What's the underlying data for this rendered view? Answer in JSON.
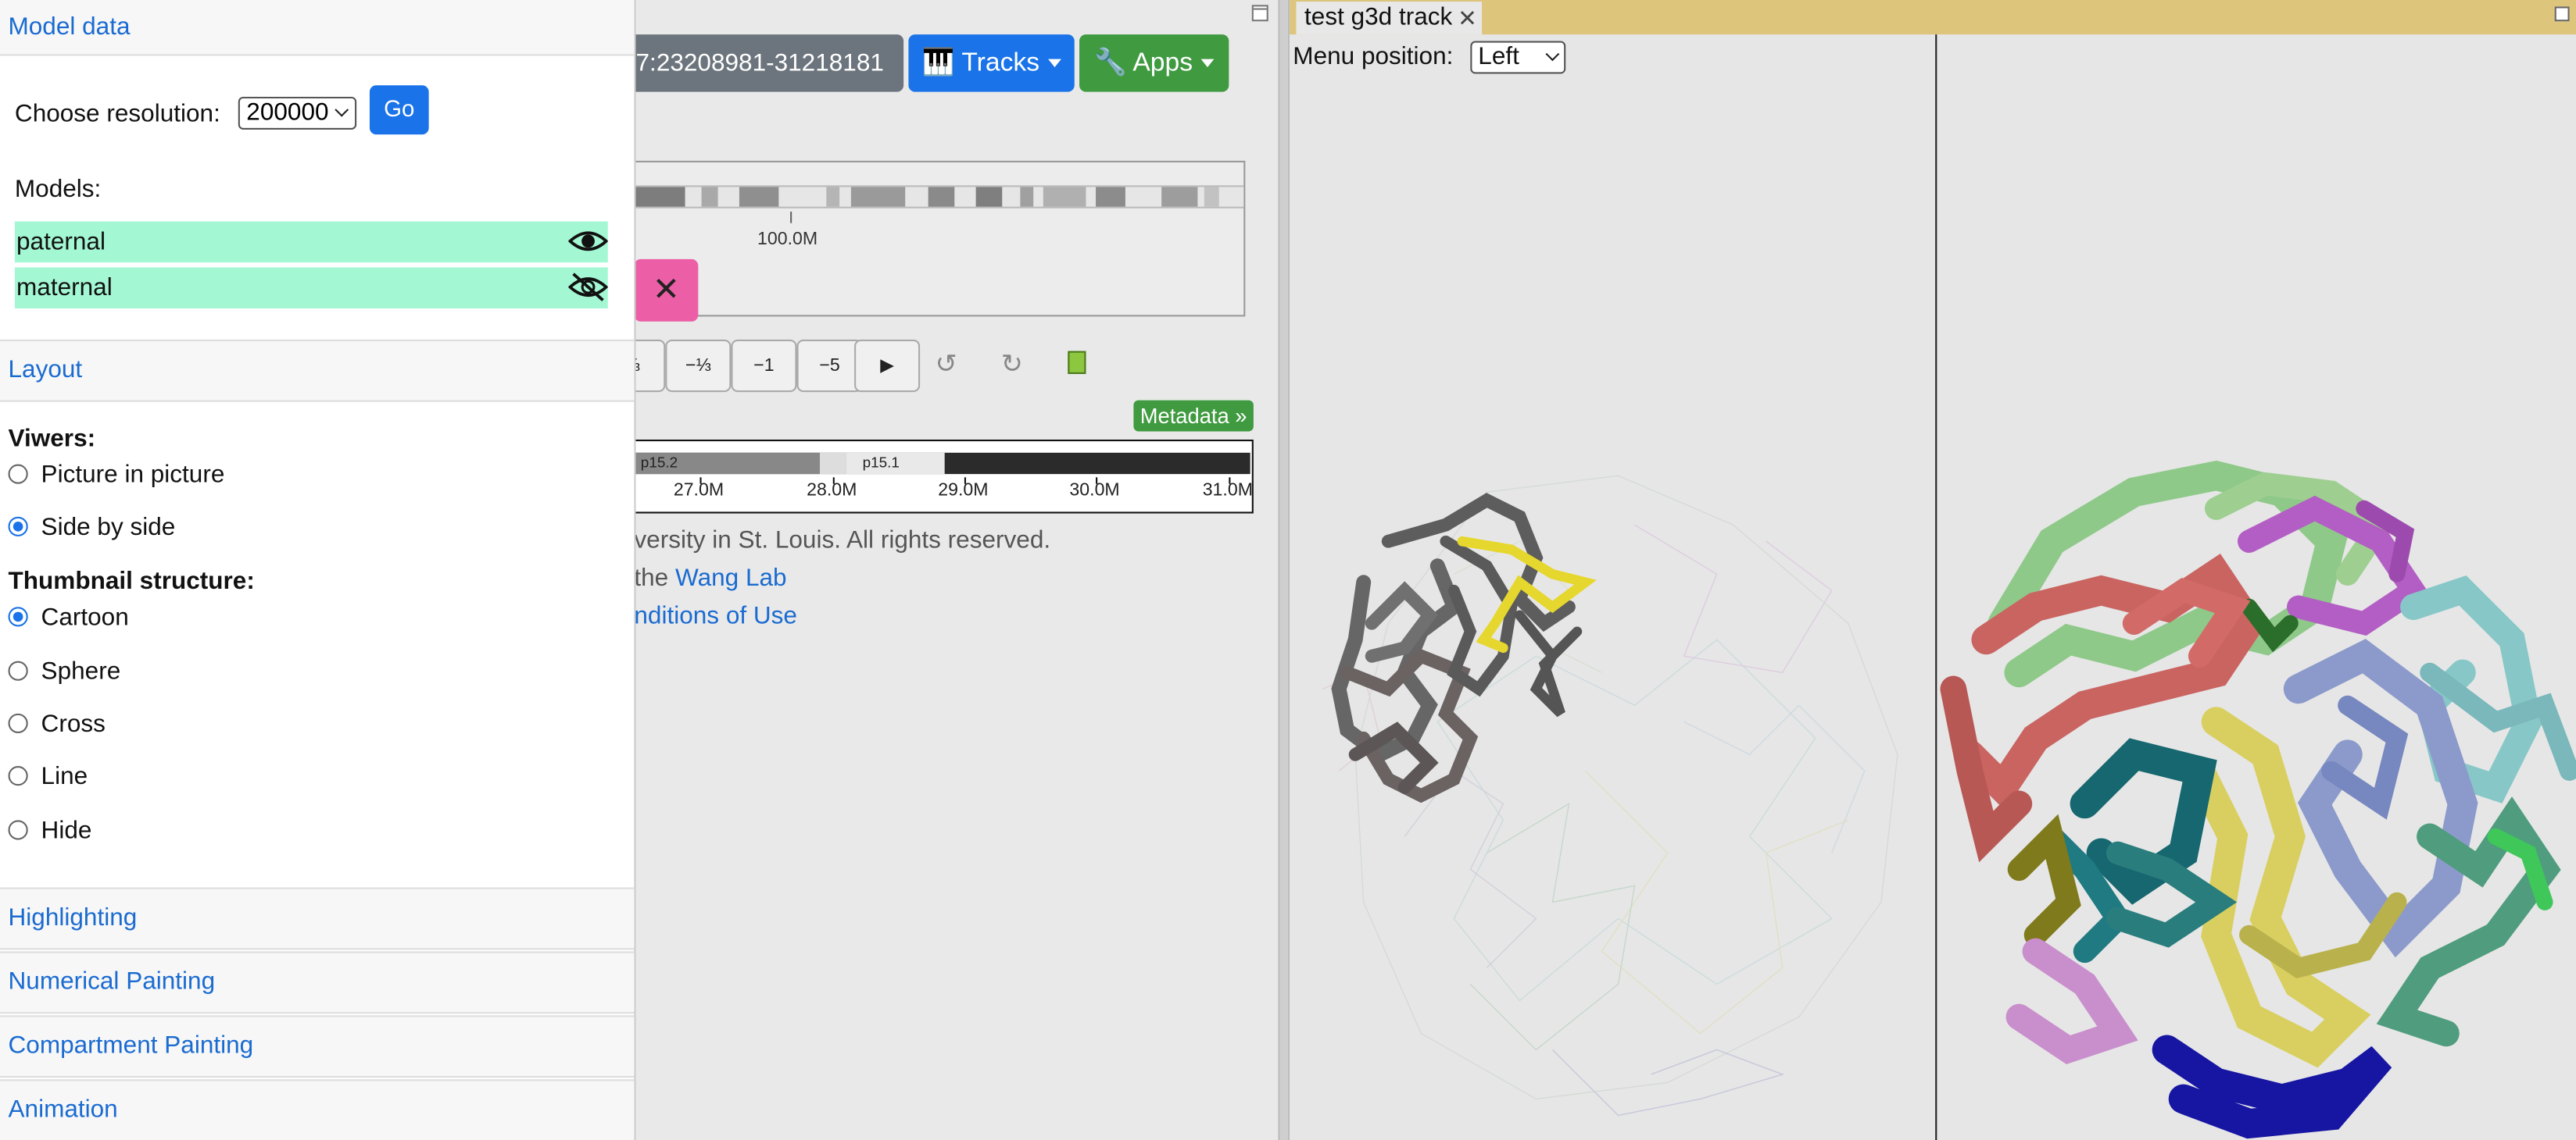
{
  "browser": {
    "locus": "7:23208981-31218181",
    "tracks_label": "Tracks",
    "apps_label": "Apps",
    "ideogram_tick": "100.0M",
    "nav_buttons": [
      "⅓",
      "−⅓",
      "−1",
      "−5",
      "▶"
    ],
    "metadata_label": "Metadata »",
    "ruler_bands": [
      "p15.2",
      "p15.1"
    ],
    "ruler_ticks": [
      "27.0M",
      "28.0M",
      "29.0M",
      "30.0M",
      "31.0M"
    ],
    "footer_line1": "versity in St. Louis. All rights reserved.",
    "footer_line2_prefix": "the",
    "footer_line2_link": "Wang Lab",
    "footer_line3_link": "nditions of Use"
  },
  "panel": {
    "tab_title": "test g3d track",
    "menu_position_label": "Menu position:",
    "menu_position_value": "Left"
  },
  "sidebar": {
    "model_data_header": "Model data",
    "resolution_label": "Choose resolution:",
    "resolution_value": "200000",
    "go_label": "Go",
    "models_label": "Models:",
    "models": [
      {
        "name": "paternal",
        "visible": true
      },
      {
        "name": "maternal",
        "visible": false
      }
    ],
    "model_row_color": "#a3f7d3",
    "layout_header": "Layout",
    "viewers_label": "Viwers:",
    "viewer_options": [
      {
        "label": "Picture in picture",
        "selected": false
      },
      {
        "label": "Side by side",
        "selected": true
      }
    ],
    "thumbnail_label": "Thumbnail structure:",
    "thumbnail_options": [
      {
        "label": "Cartoon",
        "selected": true
      },
      {
        "label": "Sphere",
        "selected": false
      },
      {
        "label": "Cross",
        "selected": false
      },
      {
        "label": "Line",
        "selected": false
      },
      {
        "label": "Hide",
        "selected": false
      }
    ],
    "section_headers": [
      "Highlighting",
      "Numerical Painting",
      "Compartment Painting",
      "Animation"
    ]
  },
  "colors": {
    "primary": "#1a73e8",
    "success": "#3f9a40",
    "tabstrip": "#ddc67c",
    "link": "#1a6bd1",
    "close_button": "#ec5fa6"
  }
}
